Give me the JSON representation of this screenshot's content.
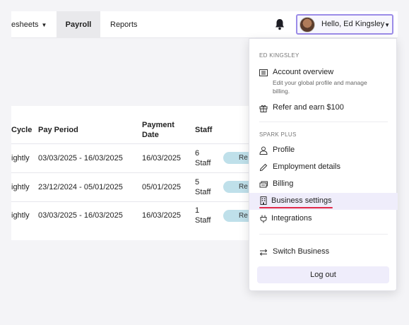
{
  "nav": {
    "timesheets_label": "esheets",
    "payroll_label": "Payroll",
    "reports_label": "Reports"
  },
  "user": {
    "greeting": "Hello, Ed Kingsley"
  },
  "table": {
    "headers": {
      "cycle": "Cycle",
      "pay_period": "Pay Period",
      "payment_date_line1": "Payment",
      "payment_date_line2": "Date",
      "staff": "Staff"
    },
    "rows": [
      {
        "cycle": "ightly",
        "pay_period": "03/03/2025 - 16/03/2025",
        "payment_date": "16/03/2025",
        "staff_line1": "6",
        "staff_line2": "Staff",
        "status": "Re"
      },
      {
        "cycle": "ightly",
        "pay_period": "23/12/2024 - 05/01/2025",
        "payment_date": "05/01/2025",
        "staff_line1": "5",
        "staff_line2": "Staff",
        "status": "Re"
      },
      {
        "cycle": "ightly",
        "pay_period": "03/03/2025 - 16/03/2025",
        "payment_date": "16/03/2025",
        "staff_line1": "1",
        "staff_line2": "Staff",
        "status": "Re"
      }
    ]
  },
  "dropdown": {
    "user_section": "ED KINGSLEY",
    "account_overview": "Account overview",
    "account_overview_desc_1": "Edit your global profile and manage",
    "account_overview_desc_2": "billing.",
    "refer": "Refer and earn $100",
    "org_section": "SPARK PLUS",
    "profile": "Profile",
    "employment": "Employment details",
    "billing": "Billing",
    "business_settings": "Business settings",
    "integrations": "Integrations",
    "switch_business": "Switch Business",
    "logout": "Log out"
  },
  "colors": {
    "accent": "#9b8ce8",
    "highlight": "#efedfb",
    "underline": "#e0294a",
    "status_pill": "#bfe0ea"
  },
  "icons": {
    "bell": "bell-icon",
    "account": "list-icon",
    "refer": "gift-icon",
    "profile": "person-icon",
    "employment": "pencil-icon",
    "billing": "money-icon",
    "business": "building-icon",
    "integrations": "plug-icon",
    "switch": "switch-arrows-icon"
  }
}
